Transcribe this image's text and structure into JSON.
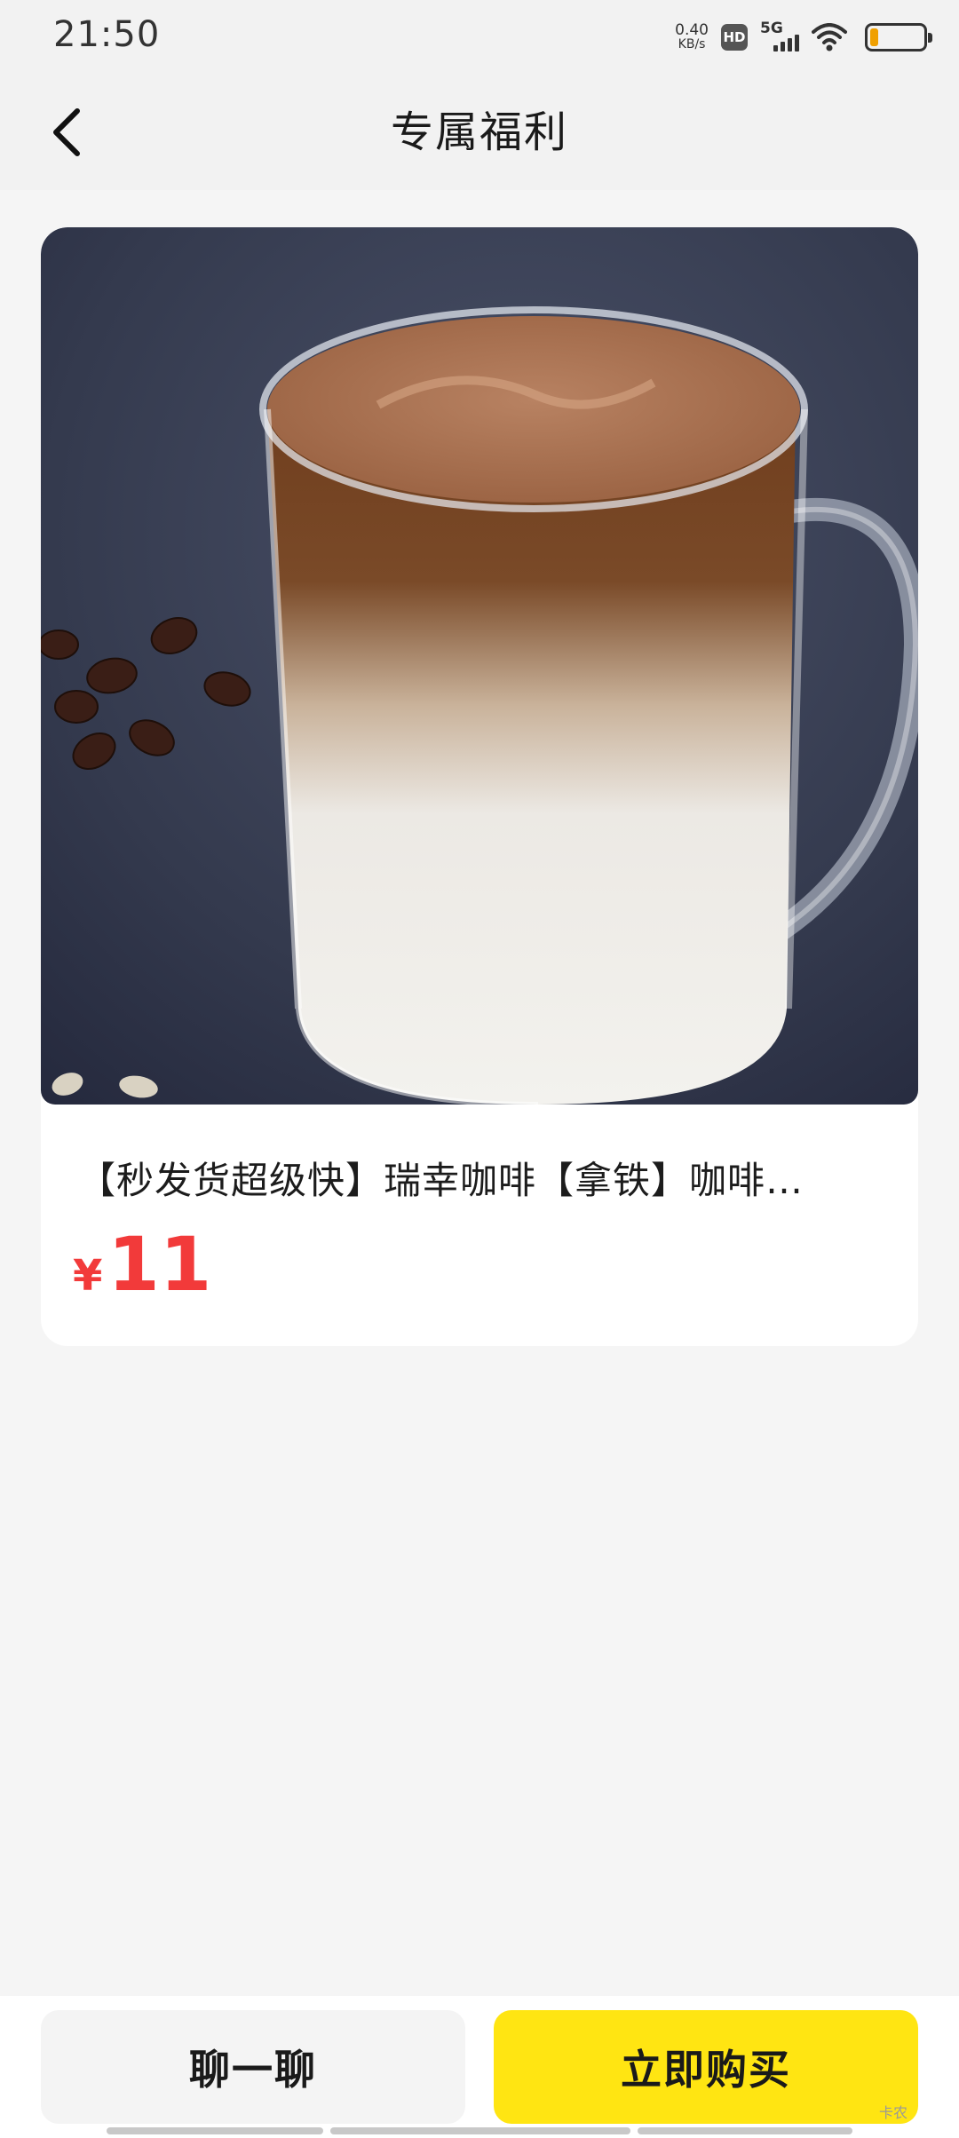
{
  "status_bar": {
    "time": "21:50",
    "net_speed_value": "0.40",
    "net_speed_unit": "KB/s",
    "hd_label": "HD",
    "network_gen": "5G",
    "battery_level": 0.15,
    "battery_color": "#f0a000"
  },
  "nav": {
    "back_icon": "chevron-left-icon",
    "title": "专属福利"
  },
  "product": {
    "image_alt": "latte-in-glass-mug",
    "title": "【秒发货超级快】瑞幸咖啡【拿铁】咖啡…",
    "currency": "¥",
    "price": "11",
    "price_color": "#f23a3a"
  },
  "actions": {
    "chat_label": "聊一聊",
    "buy_label": "立即购买",
    "buy_color": "#ffe512"
  },
  "watermark": "卡农"
}
